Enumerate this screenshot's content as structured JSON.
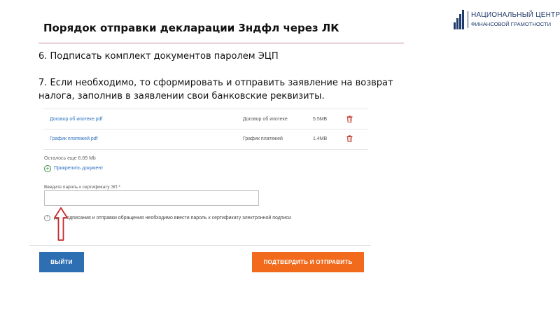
{
  "slide": {
    "title": "Порядок отправки декларации 3ндфл через ЛК",
    "step6": "6. Подписать комплект документов паролем ЭЦП",
    "step7": "7. Если необходимо, то сформировать и отправить заявление на возврат налога, заполнив в заявлении свои банковские реквизиты."
  },
  "logo": {
    "line1": "НАЦИОНАЛЬНЫЙ ЦЕНТР",
    "line2": "ФИНАНСОВОЙ ГРАМОТНОСТИ",
    "color": "#1f3a6b"
  },
  "files": [
    {
      "name": "Договор об ипотеке.pdf",
      "type": "Договор об ипотеке",
      "size": "5.5MB"
    },
    {
      "name": "График платежей.pdf",
      "type": "График платежей",
      "size": "1.4MB"
    }
  ],
  "remaining": "Осталось еще 6.89 Mb",
  "attach_label": "Прикрепить документ",
  "password": {
    "label": "Введите пароль к сертификату ЭП *",
    "value": "",
    "placeholder": ""
  },
  "info_text": "Для подписания и отправки обращения необходимо ввести пароль к сертификату электронной подписи",
  "buttons": {
    "exit": "ВЫЙТИ",
    "submit": "ПОДТВЕРДИТЬ И ОТПРАВИТЬ"
  },
  "colors": {
    "exit_button": "#2e6fb4",
    "submit_button": "#f26b1d",
    "link": "#2f73c0",
    "arrow": "#c62828",
    "trash": "#c0392b"
  }
}
